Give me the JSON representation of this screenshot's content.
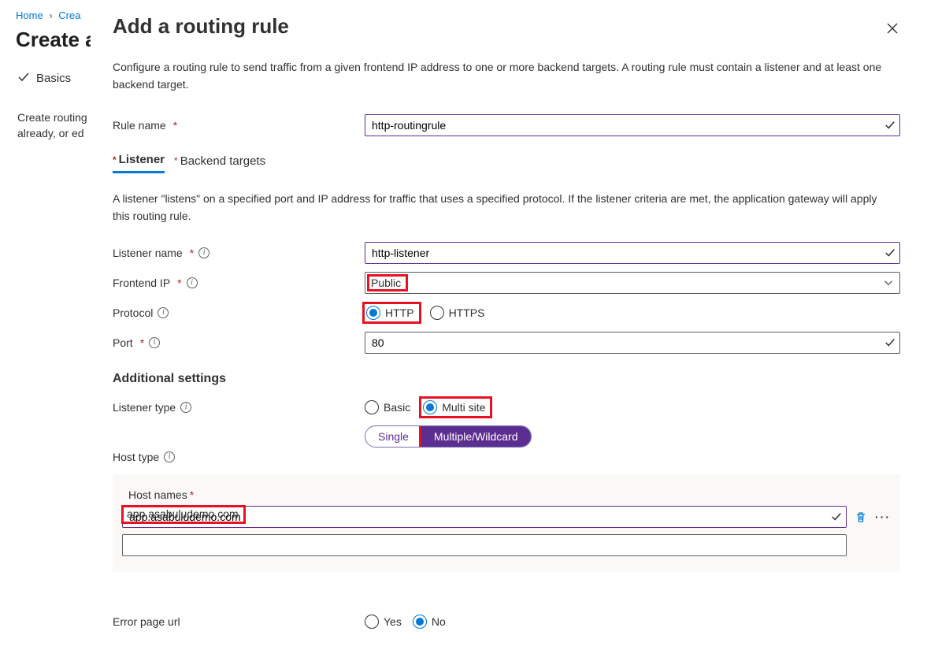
{
  "breadcrumb": {
    "home": "Home",
    "crea": "Crea"
  },
  "page_title": "Create a",
  "wizard": {
    "basics": "Basics"
  },
  "left_desc": "Create routing already, or ed",
  "panel": {
    "title": "Add a routing rule",
    "description": "Configure a routing rule to send traffic from a given frontend IP address to one or more backend targets. A routing rule must contain a listener and at least one backend target.",
    "rule_name": {
      "label": "Rule name",
      "value": "http-routingrule"
    },
    "tabs": {
      "listener": "Listener",
      "backend": "Backend targets"
    },
    "listener_desc": "A listener \"listens\" on a specified port and IP address for traffic that uses a specified protocol. If the listener criteria are met, the application gateway will apply this routing rule.",
    "listener_name": {
      "label": "Listener name",
      "value": "http-listener"
    },
    "frontend_ip": {
      "label": "Frontend IP",
      "value": "Public"
    },
    "protocol": {
      "label": "Protocol",
      "http": "HTTP",
      "https": "HTTPS"
    },
    "port": {
      "label": "Port",
      "value": "80"
    },
    "additional_settings": "Additional settings",
    "listener_type": {
      "label": "Listener type",
      "basic": "Basic",
      "multi": "Multi site"
    },
    "host_type": {
      "label": "Host type",
      "single": "Single",
      "multiple": "Multiple/Wildcard"
    },
    "host_names": {
      "label": "Host names",
      "value1": "app.asabuludemo.com",
      "value2": ""
    },
    "error_page": {
      "label": "Error page url",
      "yes": "Yes",
      "no": "No"
    }
  }
}
